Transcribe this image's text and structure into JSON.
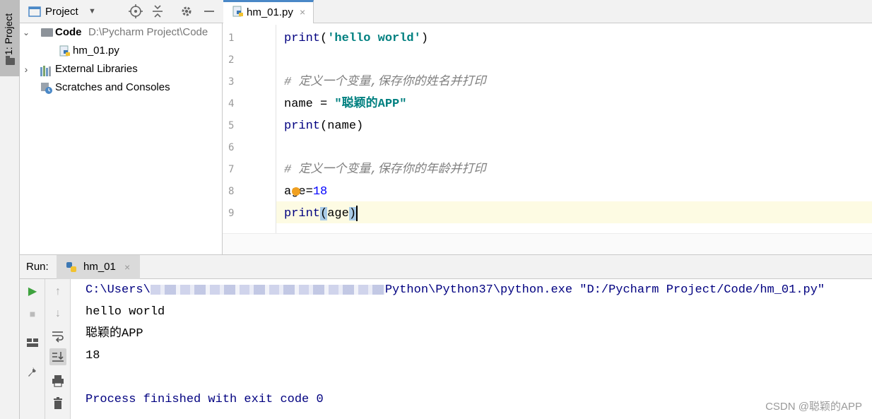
{
  "left_strip": {
    "project_tab_label": "1: Project"
  },
  "project_panel": {
    "title": "Project",
    "tree": [
      {
        "name": "Code",
        "path": "D:\\Pycharm Project\\Code"
      },
      {
        "name": "hm_01.py"
      },
      {
        "name": "External Libraries"
      },
      {
        "name": "Scratches and Consoles"
      }
    ]
  },
  "editor": {
    "tab_label": "hm_01.py",
    "line_numbers": [
      "1",
      "2",
      "3",
      "4",
      "5",
      "6",
      "7",
      "8",
      "9"
    ],
    "code": {
      "l1_fn": "print",
      "l1_open": "(",
      "l1_str": "'hello world'",
      "l1_close": ")",
      "l3_comment": "# 定义一个变量,保存你的姓名并打印",
      "l4_name": "name = ",
      "l4_str": "\"聪颖的APP\"",
      "l5_fn": "print",
      "l5_args": "(name)",
      "l7_comment": "# 定义一个变量,保存你的年龄并打印",
      "l8_var": "age=",
      "l8_num": "18",
      "l9_fn": "print",
      "l9_open": "(",
      "l9_arg": "age",
      "l9_close": ")"
    }
  },
  "run_panel": {
    "label": "Run:",
    "tab_label": "hm_01",
    "output": {
      "path_prefix": "C:\\Users\\",
      "path_suffix": "Python\\Python37\\python.exe \"D:/Pycharm Project/Code/hm_01.py\"",
      "line2": "hello world",
      "line3": "聪颖的APP",
      "line4": "18",
      "finish": "Process finished with exit code 0"
    }
  },
  "watermark": "CSDN @聪颖的APP",
  "colors": {
    "keyword_fn": "#000080",
    "string": "#008080",
    "comment": "#808080",
    "number": "#0000ff",
    "run_green": "#3fa33f",
    "current_line": "#fdfbe3"
  }
}
